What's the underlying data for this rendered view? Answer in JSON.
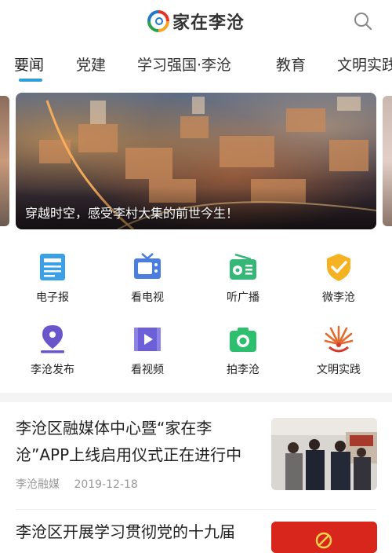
{
  "header": {
    "app_title": "家在李沧",
    "logo_icon": "swirl-logo-icon",
    "search_icon": "search-icon"
  },
  "tabs": [
    {
      "label": "要闻",
      "active": true
    },
    {
      "label": "党建",
      "active": false
    },
    {
      "label": "学习强国·李沧",
      "active": false
    },
    {
      "label": "教育",
      "active": false
    },
    {
      "label": "文明实践",
      "active": false
    }
  ],
  "banner": {
    "caption": "穿越时空，感受李村大集的前世今生！"
  },
  "services": [
    {
      "label": "电子报",
      "icon": "newspaper-icon",
      "color": "#3aa0e8"
    },
    {
      "label": "看电视",
      "icon": "tv-icon",
      "color": "#4a7de0"
    },
    {
      "label": "听广播",
      "icon": "radio-icon",
      "color": "#35b877"
    },
    {
      "label": "微李沧",
      "icon": "shield-check-icon",
      "color": "#f5b324"
    },
    {
      "label": "李沧发布",
      "icon": "pen-nib-icon",
      "color": "#6a55c9"
    },
    {
      "label": "看视频",
      "icon": "video-icon",
      "color": "#6c5fd8"
    },
    {
      "label": "拍李沧",
      "icon": "camera-icon",
      "color": "#2cbf6d"
    },
    {
      "label": "文明实践",
      "icon": "civilization-emblem-icon",
      "color": "#e46a2d"
    }
  ],
  "news": [
    {
      "title": "李沧区融媒体中心暨“家在李沧”APP上线启用仪式正在进行中",
      "source": "李沧融媒",
      "date": "2019-12-18"
    },
    {
      "title": "李沧区开展学习贯彻党的十九届",
      "source": "",
      "date": ""
    }
  ]
}
